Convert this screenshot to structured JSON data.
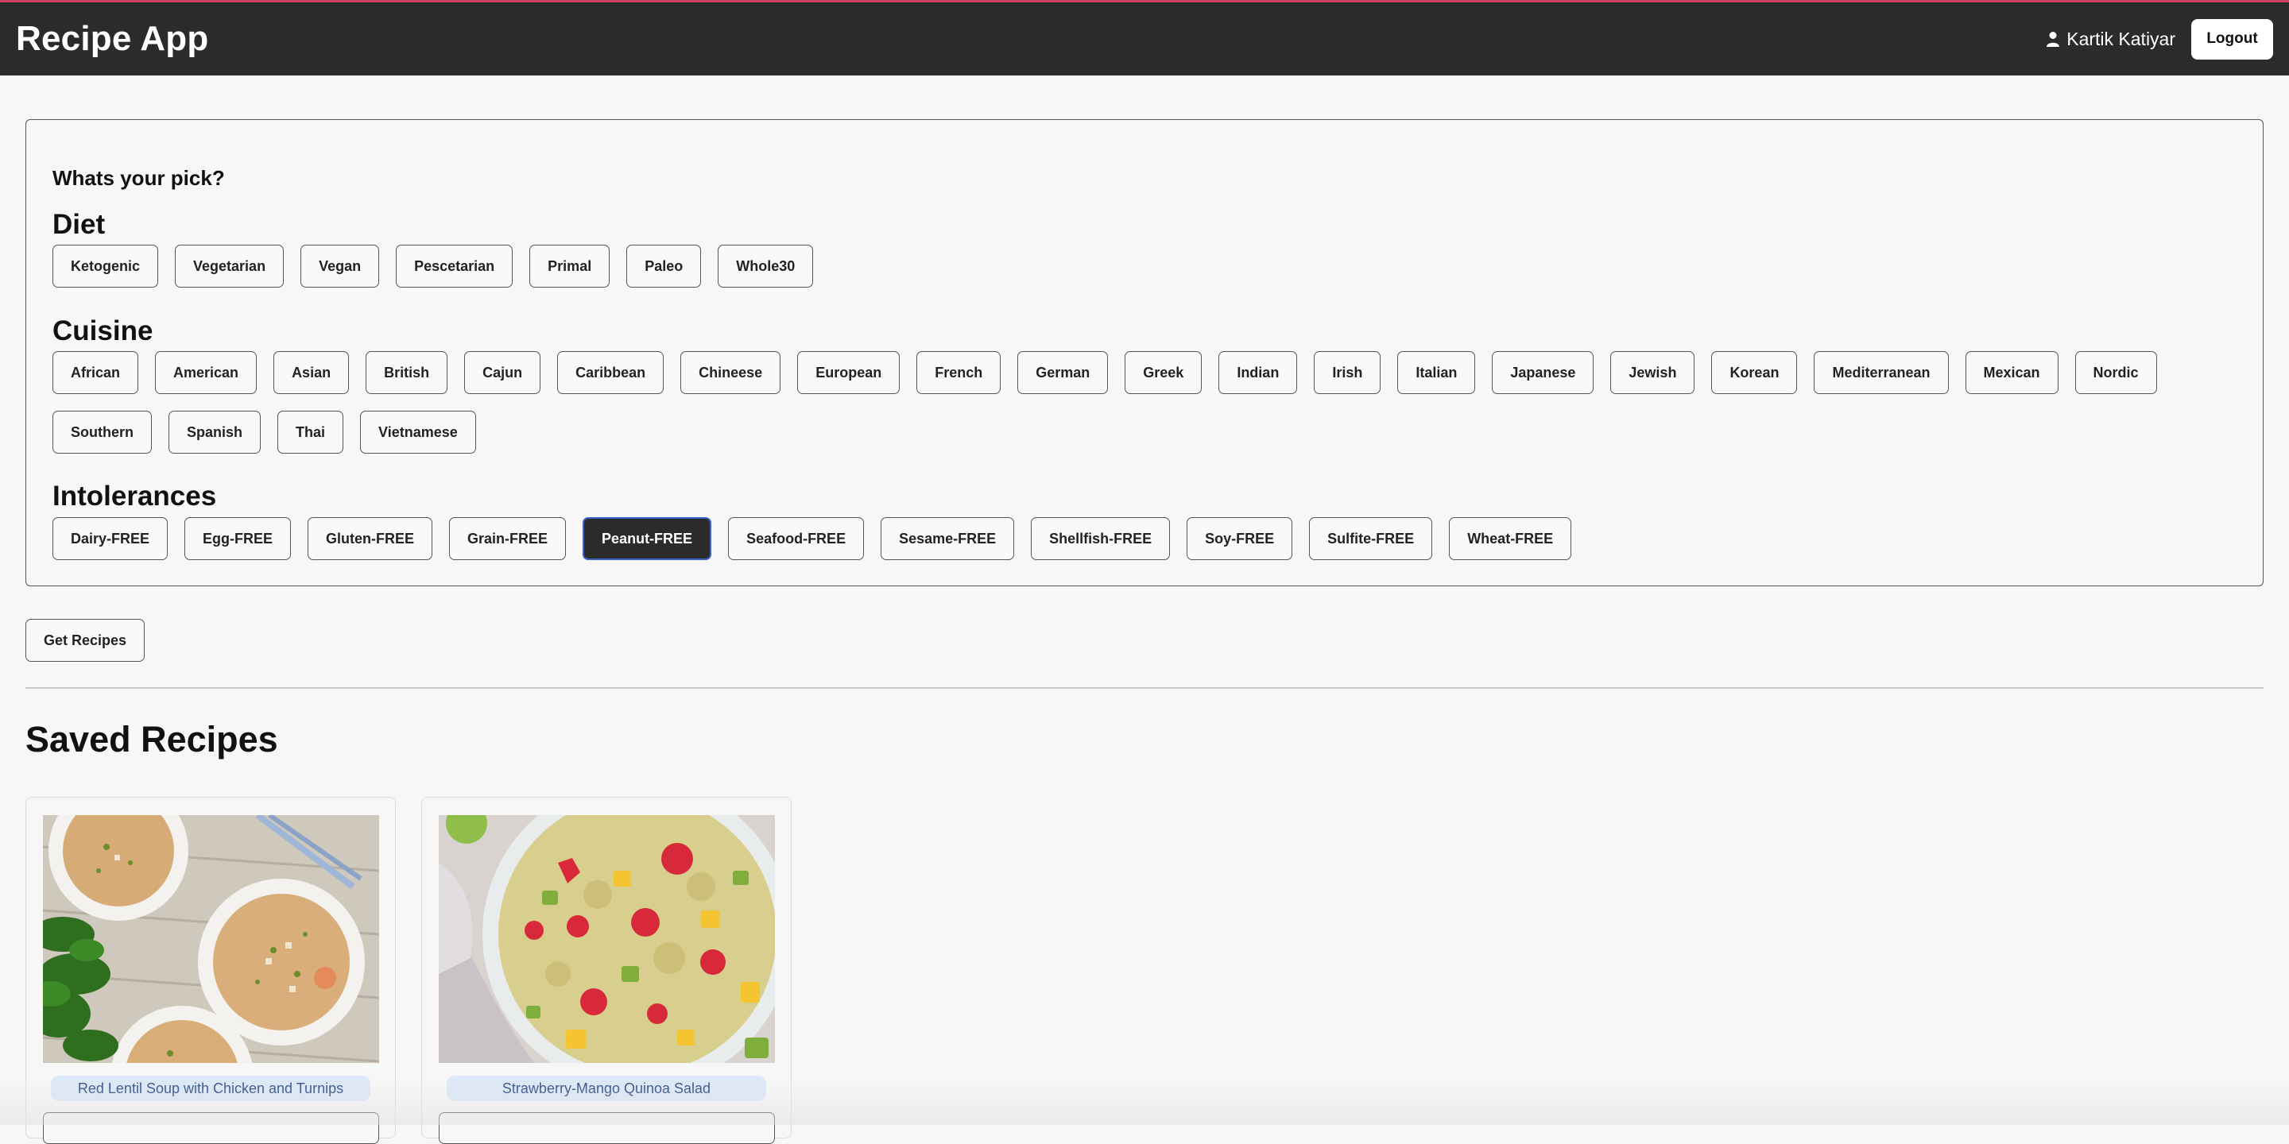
{
  "header": {
    "app_title": "Recipe App",
    "user_icon": "user-icon",
    "user_name": "Kartik Katiyar",
    "logout_label": "Logout"
  },
  "filters": {
    "prompt": "Whats your pick?",
    "diet": {
      "title": "Diet",
      "options": [
        "Ketogenic",
        "Vegetarian",
        "Vegan",
        "Pescetarian",
        "Primal",
        "Paleo",
        "Whole30"
      ]
    },
    "cuisine": {
      "title": "Cuisine",
      "options": [
        "African",
        "American",
        "Asian",
        "British",
        "Cajun",
        "Caribbean",
        "Chineese",
        "European",
        "French",
        "German",
        "Greek",
        "Indian",
        "Irish",
        "Italian",
        "Japanese",
        "Jewish",
        "Korean",
        "Mediterranean",
        "Mexican",
        "Nordic",
        "Southern",
        "Spanish",
        "Thai",
        "Vietnamese"
      ]
    },
    "intolerances": {
      "title": "Intolerances",
      "options": [
        "Dairy-FREE",
        "Egg-FREE",
        "Gluten-FREE",
        "Grain-FREE",
        "Peanut-FREE",
        "Seafood-FREE",
        "Sesame-FREE",
        "Shellfish-FREE",
        "Soy-FREE",
        "Sulfite-FREE",
        "Wheat-FREE"
      ],
      "selected": "Peanut-FREE"
    }
  },
  "get_recipes_label": "Get Recipes",
  "saved": {
    "title": "Saved Recipes",
    "recipes": [
      {
        "name": "Red Lentil Soup with Chicken and Turnips"
      },
      {
        "name": "Strawberry-Mango Quinoa Salad"
      }
    ]
  },
  "colors": {
    "header_bg": "#2b2b2b",
    "header_accent": "#c8405c",
    "selected_chip_bg": "#2b2b2b",
    "selected_chip_border": "#3a63c9",
    "recipe_label_bg": "#dde8f8",
    "recipe_label_text": "#2e4d85"
  }
}
